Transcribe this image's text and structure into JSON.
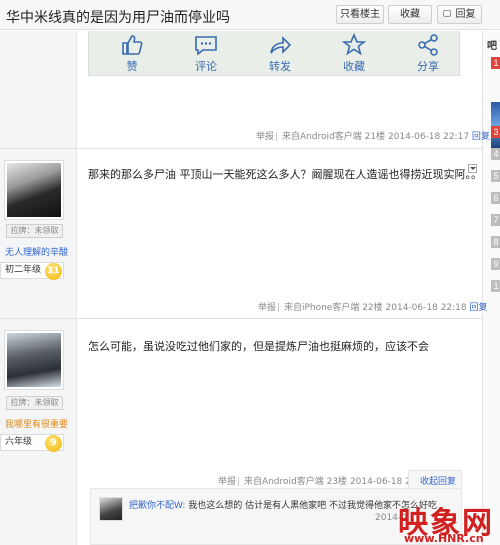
{
  "header": {
    "title": "华中米线真的是因为用尸油而停业吗",
    "buttons": {
      "only_op": "只看楼主",
      "favorite": "收藏",
      "reply": "回复"
    }
  },
  "sidebar_right": {
    "label": "吧",
    "numbers": [
      "1",
      "3",
      "4",
      "5",
      "6",
      "7",
      "8",
      "9",
      "1"
    ],
    "accent": "#e0433b"
  },
  "share_bar": {
    "items": [
      {
        "icon": "thumbs-up-icon",
        "label": "赞"
      },
      {
        "icon": "comment-icon",
        "label": "评论"
      },
      {
        "icon": "forward-icon",
        "label": "转发"
      },
      {
        "icon": "star-icon",
        "label": "收藏"
      },
      {
        "icon": "share-icon",
        "label": "分享"
      }
    ]
  },
  "posts": [
    {
      "meta": {
        "report": "举报",
        "source": "来自Android客户端",
        "floor": "21楼",
        "time": "2014-06-18 22:17",
        "reply": "回复"
      }
    },
    {
      "user": {
        "badge": "拉牌：未领取",
        "name": "无人理解的辛酸",
        "level_name": "初二年级",
        "level": "11"
      },
      "content": "那来的那么多尸油 平顶山一天能死这么多人？阚腥现在人造谣也得捞近现实阿。。",
      "meta": {
        "report": "举报",
        "source": "来自iPhone客户端",
        "floor": "22楼",
        "time": "2014-06-18 22:18",
        "reply": "回复"
      }
    },
    {
      "user": {
        "badge": "拉牌：未领取",
        "name": "我哪里有很重要",
        "level_name": "六年级",
        "level": "9"
      },
      "content": "怎么可能，虽说没吃过他们家的，但是提炼尸油也挺麻烦的，应该不会",
      "meta": {
        "report": "举报",
        "source": "来自Android客户端",
        "floor": "23楼",
        "time": "2014-06-18 22:18",
        "reply": "收起回复"
      },
      "replies": [
        {
          "user": "把歉你不配W",
          "text": "我也这么想的 估计是有人黑他家吧 不过我觉得他家不怎么好吃",
          "time": "2014-0"
        }
      ]
    }
  ],
  "watermark": {
    "logo": "映象网",
    "url": "www.HNR.cn"
  }
}
